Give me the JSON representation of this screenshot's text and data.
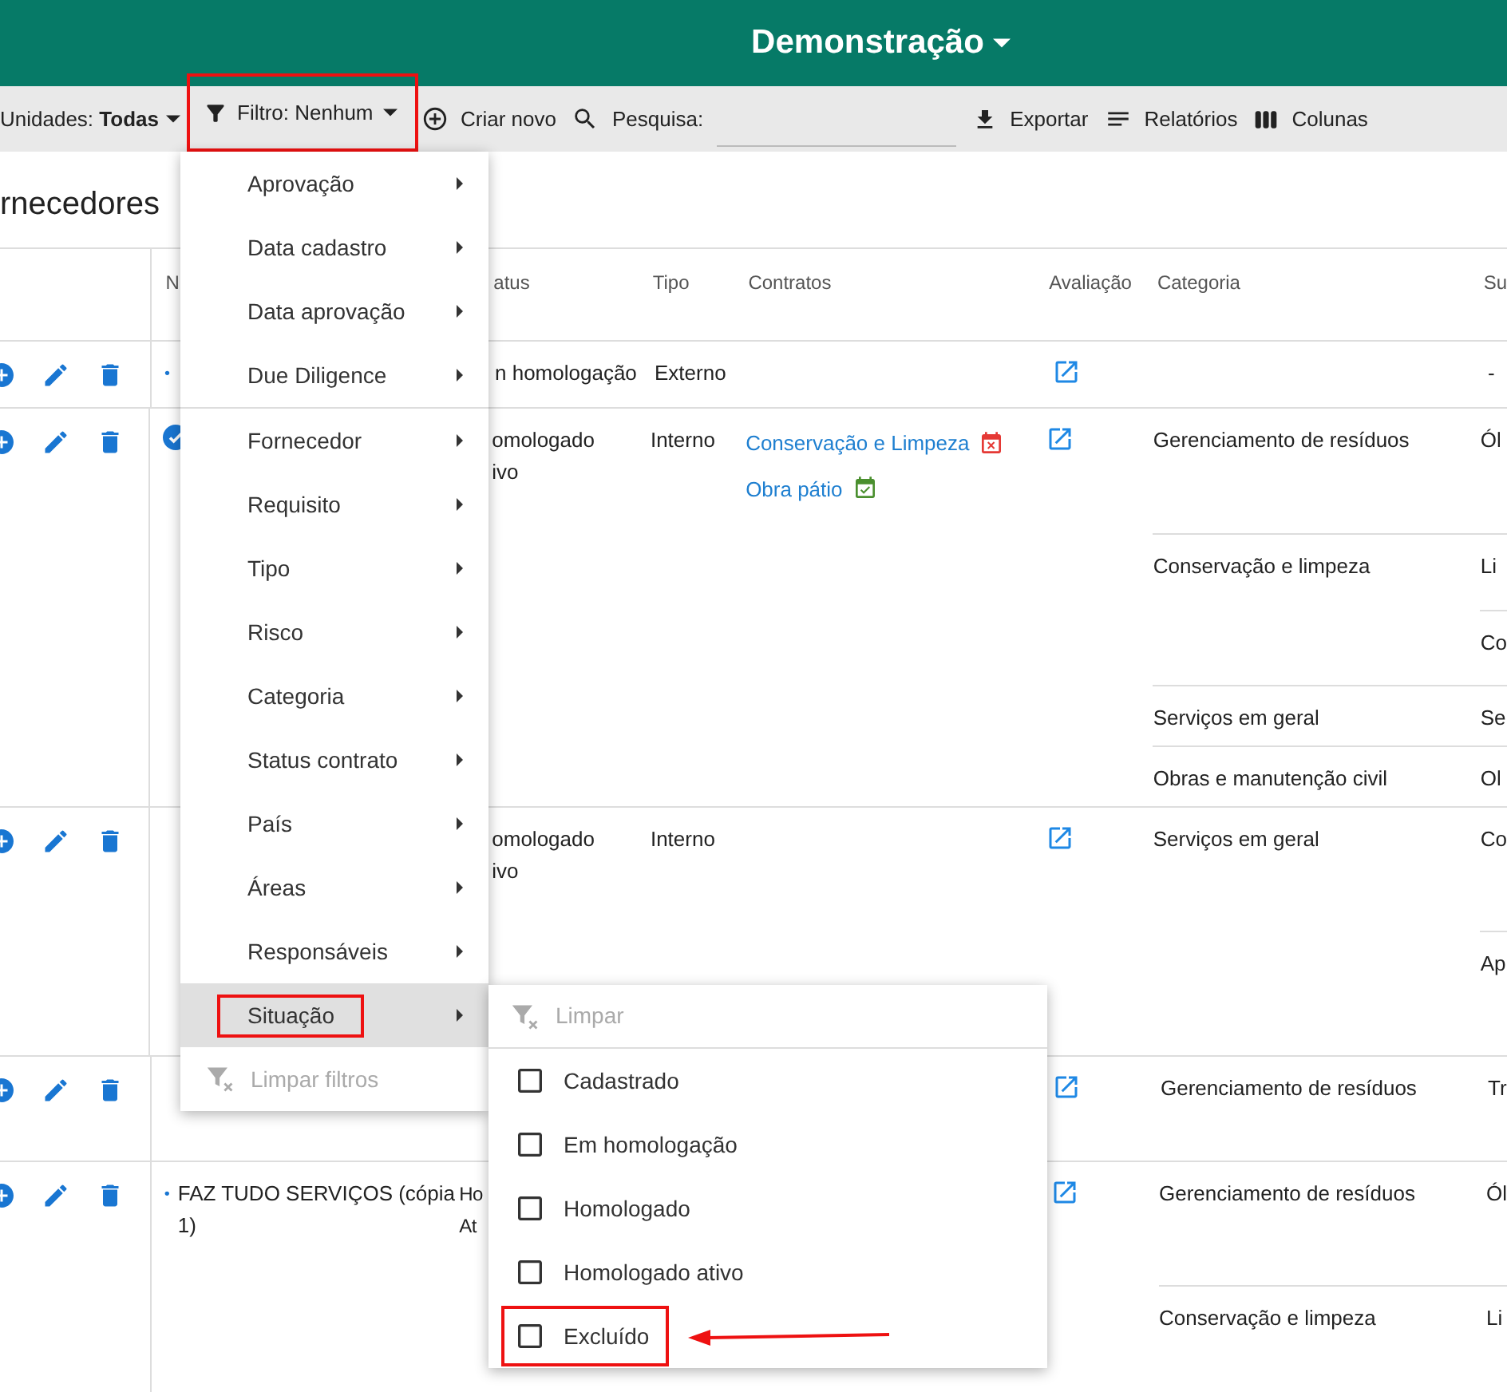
{
  "header": {
    "title": "Demonstração"
  },
  "toolbar": {
    "units_label": "Unidades:",
    "units_value": "Todas",
    "filter": {
      "label": "Filtro: Nenhum",
      "highlighted": true
    },
    "create": "Criar novo",
    "search_label": "Pesquisa:",
    "export": "Exportar",
    "reports": "Relatórios",
    "columns": "Colunas"
  },
  "page_title": "rnecedores",
  "table": {
    "columns": [
      "N",
      "atus",
      "Tipo",
      "Contratos",
      "Avaliação",
      "Categoria",
      "Su"
    ],
    "rows": [
      {
        "bullet": "•",
        "status": [
          "n homologação"
        ],
        "type": "Externo",
        "evaluation": true,
        "categories": [
          {
            "sub": [
              "-"
            ]
          }
        ]
      },
      {
        "verified": true,
        "status": [
          "omologado",
          "ivo"
        ],
        "type": "Interno",
        "contracts": [
          {
            "name": "Conservação e Limpeza",
            "overdue": true
          },
          {
            "name": "Obra pátio",
            "overdue": false
          }
        ],
        "evaluation": true,
        "categories": [
          {
            "name": "Gerenciamento de resíduos",
            "sub": [
              "Ól"
            ]
          },
          {
            "name": "Conservação e limpeza",
            "sub": [
              "Li",
              "Co"
            ]
          },
          {
            "name": "Serviços em geral",
            "sub": [
              "Se"
            ]
          },
          {
            "name": "Obras e manutenção civil",
            "sub": [
              "Ol"
            ]
          }
        ]
      },
      {
        "status": [
          "omologado",
          "ivo"
        ],
        "type": "Interno",
        "evaluation": true,
        "categories": [
          {
            "name": "Serviços em geral",
            "sub": [
              "Co",
              "Ap"
            ]
          }
        ]
      },
      {
        "evaluation": true,
        "categories": [
          {
            "name": "Gerenciamento de resíduos",
            "sub": [
              "Tr"
            ]
          }
        ]
      },
      {
        "bullet": "•",
        "name": "FAZ TUDO SERVIÇOS (cópia 1)",
        "status": [
          "Ho",
          "At"
        ],
        "evaluation": true,
        "categories": [
          {
            "name": "Gerenciamento de resíduos",
            "sub": [
              "Ól"
            ]
          },
          {
            "name": "Conservação e limpeza",
            "sub": [
              "Li"
            ]
          }
        ]
      }
    ]
  },
  "filter_menu": {
    "groups": [
      [
        {
          "label": "Aprovação",
          "selected": false,
          "highlighted": false
        },
        {
          "label": "Data cadastro",
          "selected": false,
          "highlighted": false
        },
        {
          "label": "Data aprovação",
          "selected": false,
          "highlighted": false
        },
        {
          "label": "Due Diligence",
          "selected": false,
          "highlighted": false
        }
      ],
      [
        {
          "label": "Fornecedor",
          "selected": false,
          "highlighted": false
        },
        {
          "label": "Requisito",
          "selected": false,
          "highlighted": false
        },
        {
          "label": "Tipo",
          "selected": false,
          "highlighted": false
        },
        {
          "label": "Risco",
          "selected": false,
          "highlighted": false
        },
        {
          "label": "Categoria",
          "selected": false,
          "highlighted": false
        },
        {
          "label": "Status contrato",
          "selected": false,
          "highlighted": false
        },
        {
          "label": "País",
          "selected": false,
          "highlighted": false
        },
        {
          "label": "Áreas",
          "selected": false,
          "highlighted": false
        },
        {
          "label": "Responsáveis",
          "selected": false,
          "highlighted": false
        },
        {
          "label": "Situação",
          "selected": true,
          "highlighted": true
        }
      ]
    ],
    "clear": {
      "label": "Limpar filtros",
      "disabled": true
    }
  },
  "submenu": {
    "clear": {
      "label": "Limpar",
      "disabled": true
    },
    "options": [
      {
        "label": "Cadastrado",
        "checked": false,
        "highlighted": false
      },
      {
        "label": "Em homologação",
        "checked": false,
        "highlighted": false
      },
      {
        "label": "Homologado",
        "checked": false,
        "highlighted": false
      },
      {
        "label": "Homologado ativo",
        "checked": false,
        "highlighted": false
      },
      {
        "label": "Excluído",
        "checked": false,
        "highlighted": true,
        "pointer_arrow": true
      }
    ]
  }
}
